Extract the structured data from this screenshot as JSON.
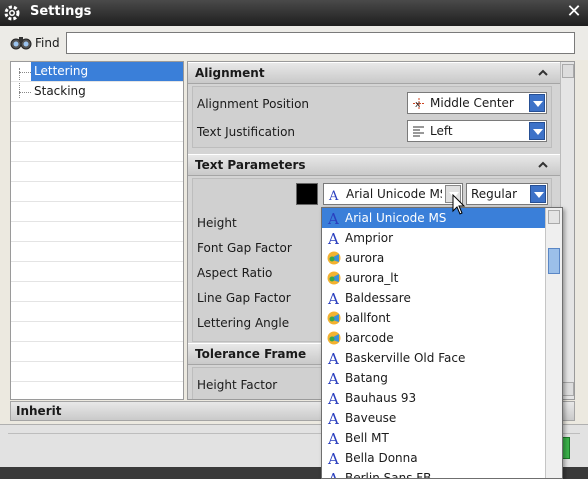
{
  "window": {
    "title": "Settings"
  },
  "find": {
    "label": "Find",
    "value": "",
    "placeholder": ""
  },
  "tree": {
    "items": [
      {
        "label": "Lettering",
        "selected": true
      },
      {
        "label": "Stacking",
        "selected": false
      }
    ]
  },
  "alignment": {
    "header": "Alignment",
    "position_label": "Alignment Position",
    "position_value": "Middle Center",
    "justification_label": "Text Justification",
    "justification_value": "Left"
  },
  "text_params": {
    "header": "Text Parameters",
    "color": "#000000",
    "font_value": "Arial Unicode MS",
    "style_value": "Regular",
    "labels": [
      "Height",
      "Font Gap Factor",
      "Aspect Ratio",
      "Line Gap Factor",
      "Lettering Angle"
    ]
  },
  "tolerance": {
    "header": "Tolerance Frame",
    "height_factor_label": "Height Factor"
  },
  "inherit": {
    "label": "Inherit"
  },
  "font_list": [
    {
      "name": "Arial Unicode MS",
      "icon": "truetype-A-icon",
      "selected": true
    },
    {
      "name": "Amprior",
      "icon": "truetype-A-icon"
    },
    {
      "name": "aurora",
      "icon": "nx-font-icon"
    },
    {
      "name": "aurora_lt",
      "icon": "nx-font-icon"
    },
    {
      "name": "Baldessare",
      "icon": "truetype-A-icon"
    },
    {
      "name": "ballfont",
      "icon": "nx-font-icon"
    },
    {
      "name": "barcode",
      "icon": "nx-font-icon"
    },
    {
      "name": "Baskerville Old Face",
      "icon": "truetype-A-icon"
    },
    {
      "name": "Batang",
      "icon": "truetype-A-icon"
    },
    {
      "name": "Bauhaus 93",
      "icon": "truetype-A-icon"
    },
    {
      "name": "Baveuse",
      "icon": "truetype-A-icon"
    },
    {
      "name": "Bell MT",
      "icon": "truetype-A-icon"
    },
    {
      "name": "Bella Donna",
      "icon": "truetype-A-icon"
    },
    {
      "name": "Berlin Sans FB",
      "icon": "truetype-A-icon"
    }
  ],
  "colors": {
    "accent": "#3a7fd9",
    "titlebar": "#2b2b2b",
    "ok": "#3cb44b"
  }
}
